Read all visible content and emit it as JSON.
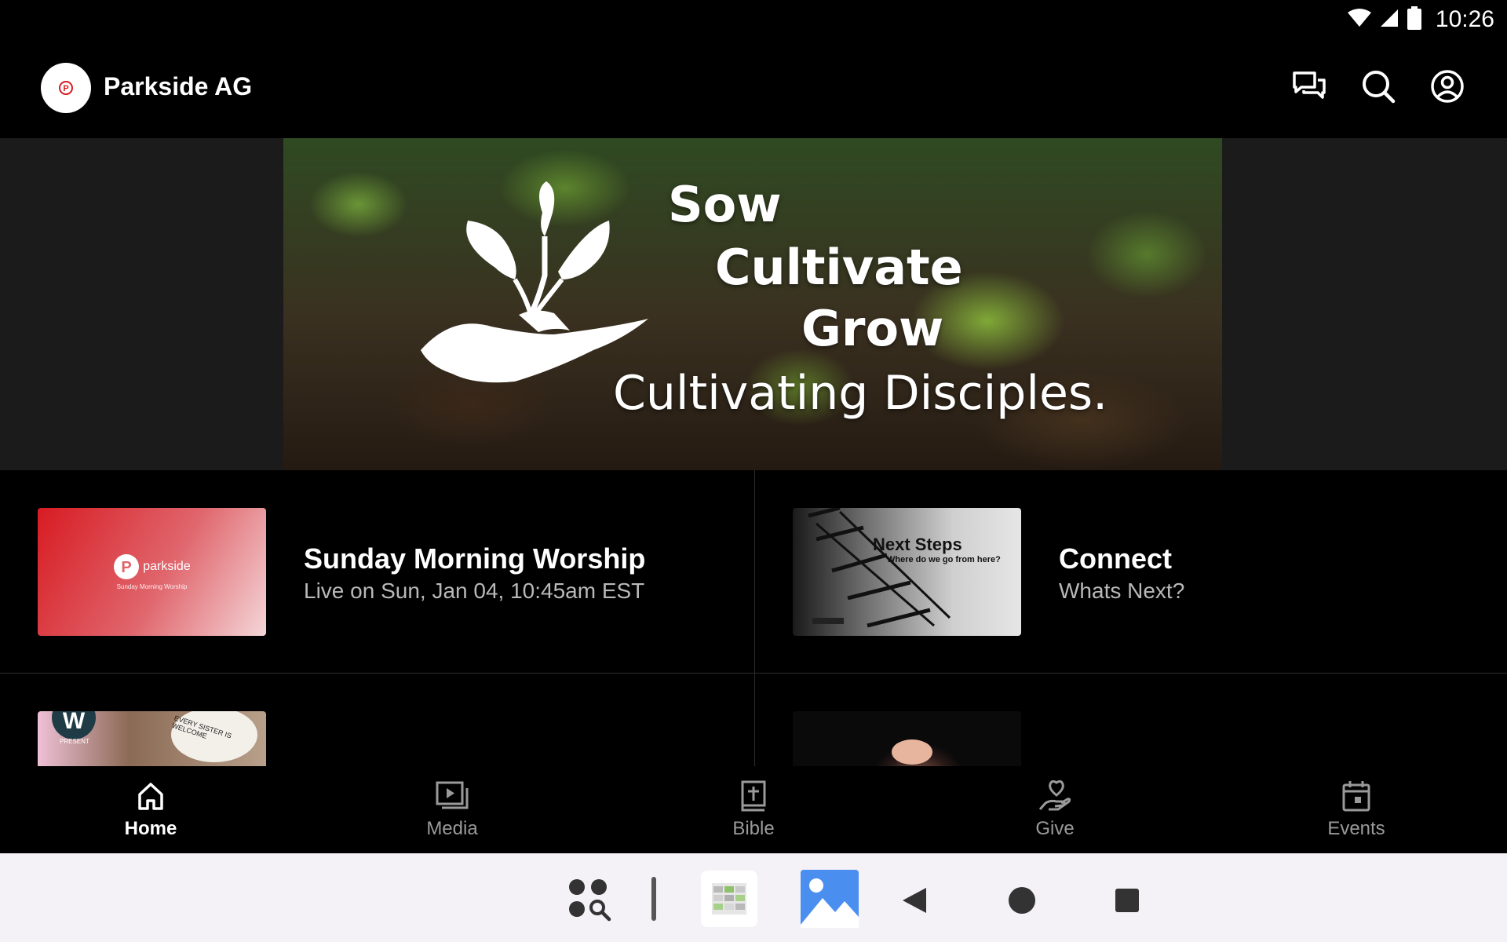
{
  "status_bar": {
    "time": "10:26"
  },
  "app": {
    "title": "Parkside AG",
    "logo_letter": "P"
  },
  "hero": {
    "line1": "Sow",
    "line2": "Cultivate",
    "line3": "Grow",
    "line4": "Cultivating Disciples."
  },
  "cards": [
    {
      "title": "Sunday Morning Worship",
      "subtitle": "Live on Sun, Jan 04, 10:45am EST",
      "thumb_brand": "parkside",
      "thumb_caption": "Sunday Morning Worship"
    },
    {
      "title": "Connect",
      "subtitle": "Whats Next?",
      "thumb_title": "Next Steps",
      "thumb_sub": "Where do we go from here?"
    },
    {
      "title": "",
      "subtitle": "",
      "thumb_badge": "W",
      "thumb_tag": "PRESENT",
      "thumb_cup": "EVERY SISTER IS WELCOME"
    },
    {
      "title": "",
      "subtitle": ""
    }
  ],
  "bottom_nav": [
    {
      "label": "Home",
      "icon": "home-icon",
      "active": true
    },
    {
      "label": "Media",
      "icon": "media-icon"
    },
    {
      "label": "Bible",
      "icon": "bible-icon"
    },
    {
      "label": "Give",
      "icon": "give-icon"
    },
    {
      "label": "Events",
      "icon": "events-icon"
    }
  ],
  "colors": {
    "accent": "#d81b22",
    "background": "#000000",
    "nav_inactive": "#9a9a9a"
  }
}
